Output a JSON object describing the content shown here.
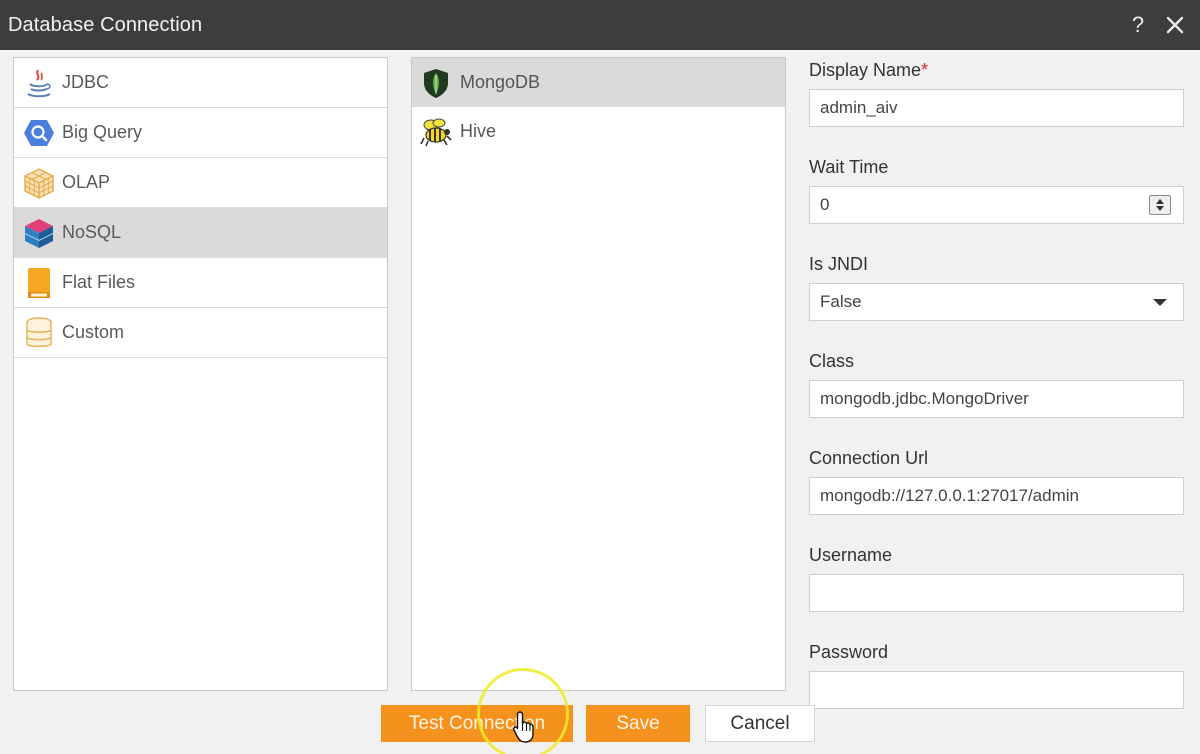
{
  "window": {
    "title": "Database Connection",
    "help_icon": "help-icon",
    "close_icon": "close-icon"
  },
  "categories": [
    {
      "label": "JDBC",
      "icon": "java-icon",
      "selected": false
    },
    {
      "label": "Big Query",
      "icon": "bigquery-icon",
      "selected": false
    },
    {
      "label": "OLAP",
      "icon": "olap-cube-icon",
      "selected": false
    },
    {
      "label": "NoSQL",
      "icon": "nosql-cube-icon",
      "selected": true
    },
    {
      "label": "Flat Files",
      "icon": "flat-file-icon",
      "selected": false
    },
    {
      "label": "Custom",
      "icon": "database-icon",
      "selected": false
    }
  ],
  "sources": [
    {
      "label": "MongoDB",
      "icon": "mongodb-leaf-icon",
      "selected": true
    },
    {
      "label": "Hive",
      "icon": "hive-bee-icon",
      "selected": false
    }
  ],
  "form": {
    "display_name": {
      "label": "Display Name",
      "required_mark": "*",
      "value": "admin_aiv"
    },
    "wait_time": {
      "label": "Wait Time",
      "value": "0"
    },
    "is_jndi": {
      "label": "Is JNDI",
      "value": "False"
    },
    "class": {
      "label": "Class",
      "value": "mongodb.jdbc.MongoDriver"
    },
    "connection_url": {
      "label": "Connection Url",
      "value": "mongodb://127.0.0.1:27017/admin"
    },
    "username": {
      "label": "Username",
      "value": ""
    },
    "password": {
      "label": "Password",
      "value": ""
    }
  },
  "buttons": {
    "test_connection": "Test Connection",
    "save": "Save",
    "cancel": "Cancel"
  },
  "colors": {
    "titlebar": "#3d3d3d",
    "accent": "#f5921e",
    "required": "#d9232d",
    "selected_row": "#dadada"
  }
}
